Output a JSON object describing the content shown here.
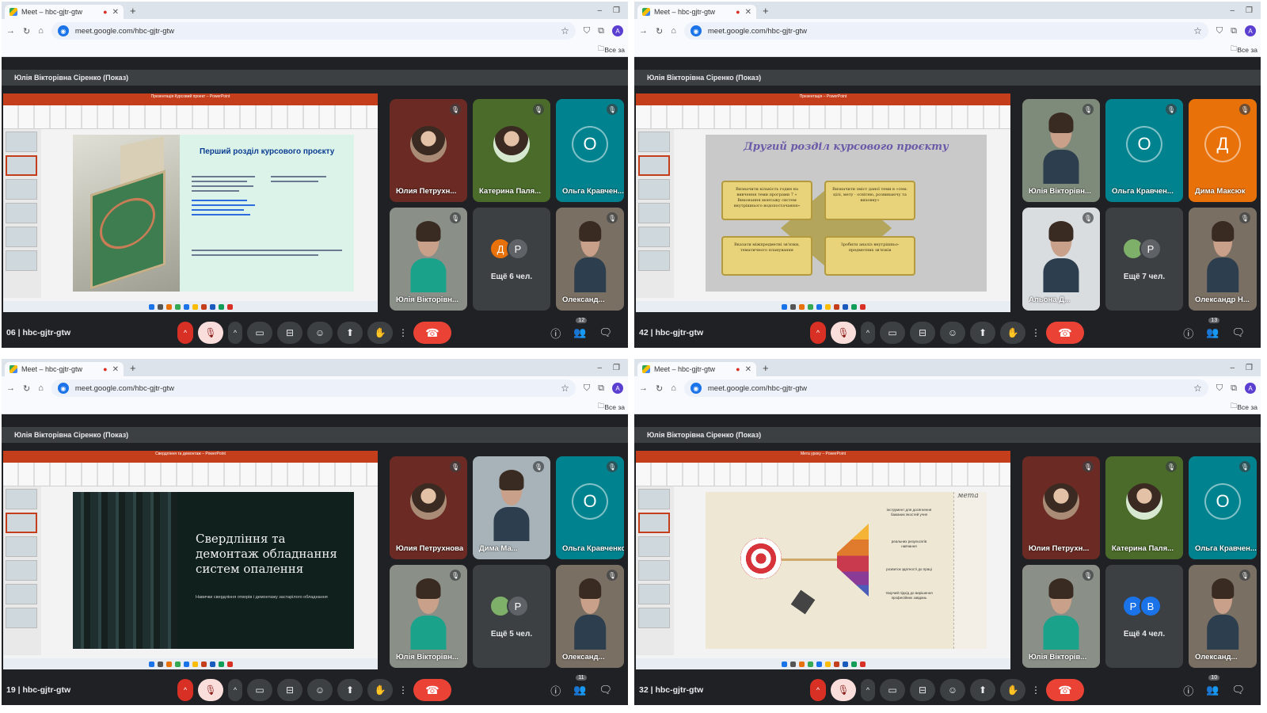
{
  "colors": {
    "meet_bg": "#202124",
    "tile_dark": "#3c4043",
    "teal_avatar": "#00838f",
    "orange_avatar": "#e8710a",
    "end_call_red": "#ea4335",
    "ppt_accent": "#c43e1c"
  },
  "browser": {
    "tab_title": "Meet – hbc-gjtr-gtw",
    "url": "meet.google.com/hbc-gjtr-gtw",
    "bookmarks_label": "Все за"
  },
  "panels": [
    {
      "presenting_label": "Юлія Вікторівна Сіренко (Показ)",
      "clock_fragment": "06",
      "meeting_code": "hbc-gjtr-gtw",
      "participant_count": "12",
      "slide": {
        "kind": "s1",
        "title": "Перший розділ курсового проєкту",
        "window_title": "Презентація Курсовий проект – PowerPoint"
      },
      "tiles": [
        {
          "name": "Юлия Петрухн...",
          "kind": "photo",
          "bg": "#6b2a23"
        },
        {
          "name": "Катерина Паля...",
          "kind": "photo",
          "bg": "#4a6b2a"
        },
        {
          "name": "Ольга Кравчен...",
          "kind": "letter",
          "letter": "О",
          "bg": "#00838f"
        },
        {
          "name": "Юлія Вікторівн...",
          "kind": "person",
          "bg": "#8a8f88"
        },
        {
          "name": "Ещё 6 чел.",
          "kind": "more",
          "chips": [
            {
              "letter": "Д",
              "color": "#e8710a"
            },
            {
              "letter": "Р",
              "color": "#5f6368"
            }
          ]
        },
        {
          "name": "Олександ...",
          "kind": "person",
          "bg": "#7a6f63"
        }
      ]
    },
    {
      "presenting_label": "Юлія Вікторівна Сіренко (Показ)",
      "clock_fragment": "42",
      "meeting_code": "hbc-gjtr-gtw",
      "participant_count": "13",
      "slide": {
        "kind": "s2",
        "title": "Другий розділ курсового проєкту",
        "window_title": "Презентація – PowerPoint",
        "boxes": [
          "Визначити кількість годин на вивчення теми програми 7 « Виконання монтажу систем внутрішнього водопостачання»",
          "Визначити зміст даної теми в «сем: цілі, мету · освітню, розвиваючу та виховну»",
          "Вказати міжпредметні зв'язки, тематичного планування",
          "Зробити аналіз внутрішньо-предметних зв'язків"
        ]
      },
      "tiles": [
        {
          "name": "Юлія Вікторівн...",
          "kind": "person",
          "bg": "#7e8a7a"
        },
        {
          "name": "Ольга Кравчен...",
          "kind": "letter",
          "letter": "О",
          "bg": "#00838f"
        },
        {
          "name": "Дима Максюк",
          "kind": "letter",
          "letter": "Д",
          "bg": "#e8710a"
        },
        {
          "name": "Альона Д...",
          "kind": "person",
          "bg": "#d9dde0"
        },
        {
          "name": "Ещё 7 чел.",
          "kind": "more",
          "chips": [
            {
              "letter": "",
              "color": "#7fb069"
            },
            {
              "letter": "Р",
              "color": "#5f6368"
            }
          ]
        },
        {
          "name": "Олександр Н...",
          "kind": "person",
          "bg": "#7a6f63"
        }
      ]
    },
    {
      "presenting_label": "Юлія Вікторівна Сіренко (Показ)",
      "clock_fragment": "19",
      "meeting_code": "hbc-gjtr-gtw",
      "participant_count": "11",
      "slide": {
        "kind": "s3",
        "title": "Свердління та демонтаж обладнання систем опалення",
        "subtitle": "Навички свердління отворів і демонтажу застарілого обладнання",
        "window_title": "Свердління та демонтаж – PowerPoint"
      },
      "tiles": [
        {
          "name": "Юлия Петрухнова",
          "kind": "photo",
          "bg": "#6b2a23"
        },
        {
          "name": "Дима Ма...",
          "kind": "person",
          "bg": "#a7b3b8"
        },
        {
          "name": "Ольга Кравченко",
          "kind": "letter",
          "letter": "О",
          "bg": "#00838f"
        },
        {
          "name": "Юлія Вікторівн...",
          "kind": "person",
          "bg": "#8a8f88"
        },
        {
          "name": "Ещё 5 чел.",
          "kind": "more",
          "chips": [
            {
              "letter": "",
              "color": "#7fb069"
            },
            {
              "letter": "Р",
              "color": "#5f6368"
            }
          ]
        },
        {
          "name": "Олександ...",
          "kind": "person",
          "bg": "#7a6f63"
        }
      ]
    },
    {
      "presenting_label": "Юлія Вікторівна Сіренко (Показ)",
      "clock_fragment": "32",
      "meeting_code": "hbc-gjtr-gtw",
      "participant_count": "10",
      "slide": {
        "kind": "s4",
        "window_title": "Мета уроку – PowerPoint",
        "texts": [
          "інструмент для досягнення бажаних якостей учня",
          "реальних результатів навчання",
          "розвиток здатності до праці",
          "творчий підхід до вирішення професійних завдань"
        ],
        "paper_text": "мета"
      },
      "tiles": [
        {
          "name": "Юлия Петрухн...",
          "kind": "photo",
          "bg": "#6b2a23"
        },
        {
          "name": "Катерина Паля...",
          "kind": "photo",
          "bg": "#4a6b2a"
        },
        {
          "name": "Ольга Кравчен...",
          "kind": "letter",
          "letter": "О",
          "bg": "#00838f"
        },
        {
          "name": "Юлія Вікторів...",
          "kind": "person",
          "bg": "#8a8f88"
        },
        {
          "name": "Ещё 4 чел.",
          "kind": "more",
          "chips": [
            {
              "letter": "Р",
              "color": "#1a73e8"
            },
            {
              "letter": "В",
              "color": "#1a73e8"
            }
          ]
        },
        {
          "name": "Олександ...",
          "kind": "person",
          "bg": "#7a6f63"
        }
      ]
    }
  ]
}
